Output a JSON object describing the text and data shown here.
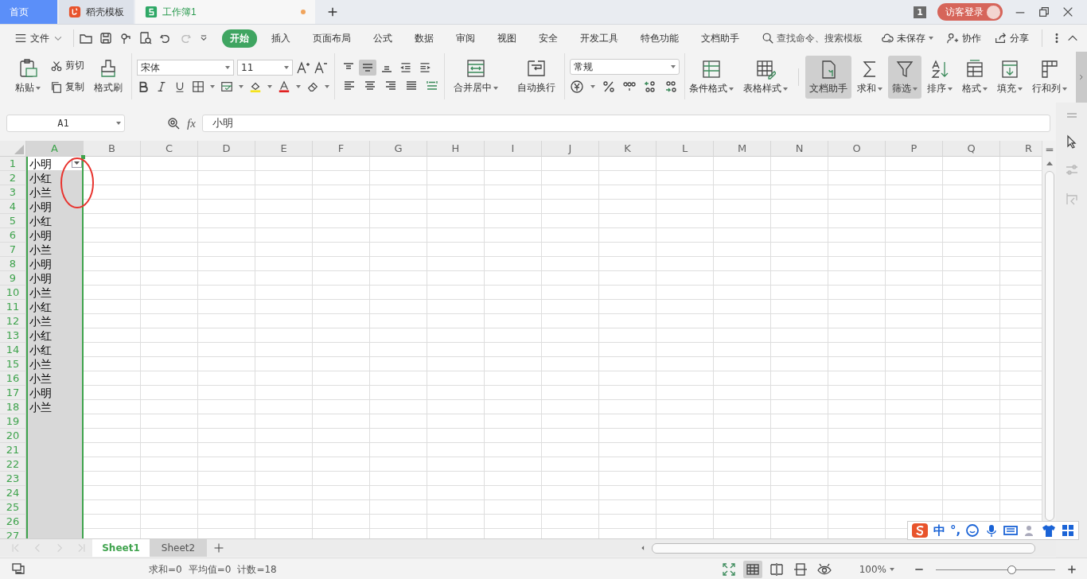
{
  "title_tabs": [
    {
      "label": "首页",
      "kind": "home",
      "selected": false,
      "unsaved": false
    },
    {
      "label": "稻壳模板",
      "kind": "docer",
      "selected": false,
      "unsaved": false
    },
    {
      "label": "工作簿1",
      "kind": "sheet",
      "selected": true,
      "unsaved": true
    }
  ],
  "page_badge": "1",
  "login_button": "访客登录",
  "file_menu": "文件",
  "menu_tabs": [
    {
      "label": "开始",
      "selected": true
    },
    {
      "label": "插入",
      "selected": false
    },
    {
      "label": "页面布局",
      "selected": false
    },
    {
      "label": "公式",
      "selected": false
    },
    {
      "label": "数据",
      "selected": false
    },
    {
      "label": "审阅",
      "selected": false
    },
    {
      "label": "视图",
      "selected": false
    },
    {
      "label": "安全",
      "selected": false
    },
    {
      "label": "开发工具",
      "selected": false
    },
    {
      "label": "特色功能",
      "selected": false
    },
    {
      "label": "文档助手",
      "selected": false
    }
  ],
  "search": {
    "placeholder": "查找命令、搜索模板"
  },
  "menu_actions": [
    "未保存",
    "协作",
    "分享"
  ],
  "clipboard": {
    "paste": "粘贴",
    "cut": "剪切",
    "copy": "复制",
    "format_painter": "格式刷"
  },
  "font": {
    "name": "宋体",
    "size": "11"
  },
  "align_buttons": [
    {
      "selected": false
    },
    {
      "selected": true
    },
    {
      "selected": false
    },
    {
      "selected": false
    },
    {
      "selected": false
    }
  ],
  "merge": "合并居中",
  "wrap": "自动换行",
  "number_format": "常规",
  "large_buttons": [
    {
      "label": "条件格式",
      "dropdown": true,
      "selected": false
    },
    {
      "label": "表格样式",
      "dropdown": true,
      "selected": false
    },
    {
      "label": "文档助手",
      "dropdown": false,
      "selected": true
    },
    {
      "label": "求和",
      "dropdown": true,
      "selected": false
    },
    {
      "label": "筛选",
      "dropdown": true,
      "selected": true
    },
    {
      "label": "排序",
      "dropdown": true,
      "selected": false
    },
    {
      "label": "格式",
      "dropdown": true,
      "selected": false
    },
    {
      "label": "填充",
      "dropdown": true,
      "selected": false
    },
    {
      "label": "行和列",
      "dropdown": true,
      "selected": false
    }
  ],
  "name_box": "A1",
  "function_label": "fx",
  "formula": "小明",
  "columns": [
    {
      "label": "A",
      "selected": true
    },
    {
      "label": "B",
      "selected": false
    },
    {
      "label": "C",
      "selected": false
    },
    {
      "label": "D",
      "selected": false
    },
    {
      "label": "E",
      "selected": false
    },
    {
      "label": "F",
      "selected": false
    },
    {
      "label": "G",
      "selected": false
    },
    {
      "label": "H",
      "selected": false
    },
    {
      "label": "I",
      "selected": false
    },
    {
      "label": "J",
      "selected": false
    },
    {
      "label": "K",
      "selected": false
    },
    {
      "label": "L",
      "selected": false
    },
    {
      "label": "M",
      "selected": false
    },
    {
      "label": "N",
      "selected": false
    },
    {
      "label": "O",
      "selected": false
    },
    {
      "label": "P",
      "selected": false
    },
    {
      "label": "Q",
      "selected": false
    },
    {
      "label": "R",
      "selected": false
    }
  ],
  "autofilter": true,
  "rows": [
    {
      "number": "1",
      "value": "小明"
    },
    {
      "number": "2",
      "value": "小红"
    },
    {
      "number": "3",
      "value": "小兰"
    },
    {
      "number": "4",
      "value": "小明"
    },
    {
      "number": "5",
      "value": "小红"
    },
    {
      "number": "6",
      "value": "小明"
    },
    {
      "number": "7",
      "value": "小兰"
    },
    {
      "number": "8",
      "value": "小明"
    },
    {
      "number": "9",
      "value": "小明"
    },
    {
      "number": "10",
      "value": "小兰"
    },
    {
      "number": "11",
      "value": "小红"
    },
    {
      "number": "12",
      "value": "小兰"
    },
    {
      "number": "13",
      "value": "小红"
    },
    {
      "number": "14",
      "value": "小红"
    },
    {
      "number": "15",
      "value": "小兰"
    },
    {
      "number": "16",
      "value": "小兰"
    },
    {
      "number": "17",
      "value": "小明"
    },
    {
      "number": "18",
      "value": "小兰"
    },
    {
      "number": "19"
    },
    {
      "number": "20"
    },
    {
      "number": "21"
    },
    {
      "number": "22"
    },
    {
      "number": "23"
    },
    {
      "number": "24"
    },
    {
      "number": "25"
    },
    {
      "number": "26"
    },
    {
      "number": "27"
    }
  ],
  "sheets": [
    {
      "label": "Sheet1",
      "selected": true
    },
    {
      "label": "Sheet2",
      "selected": false
    }
  ],
  "status": [
    "求和=0",
    "平均值=0",
    "计数=18"
  ],
  "view_buttons": [
    {
      "selected": false
    },
    {
      "selected": true
    },
    {
      "selected": false
    },
    {
      "selected": false
    },
    {
      "selected": false
    }
  ],
  "zoom": {
    "reading": "100%",
    "level": 0.64
  },
  "ime_toolbar": {
    "mode": "中",
    "punctuation": "°,"
  }
}
